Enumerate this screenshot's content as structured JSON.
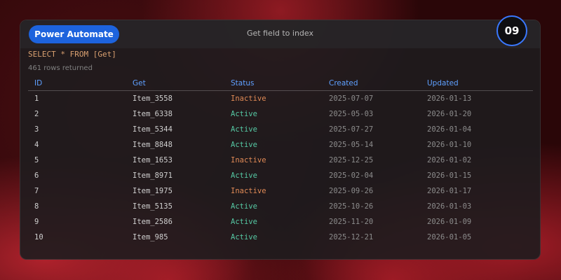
{
  "header": {
    "app_button_label": "Power Automate",
    "title": "Get field to index",
    "step_badge": "09"
  },
  "query": "SELECT * FROM [Get]",
  "row_count_text": "461 rows returned",
  "colors": {
    "accent_blue": "#1d63dd",
    "active_status": "#56c9a4",
    "inactive_status": "#e08a56",
    "header_text": "#5fa0ff"
  },
  "table": {
    "columns": [
      "ID",
      "Get",
      "Status",
      "Created",
      "Updated"
    ],
    "rows": [
      {
        "id": "1",
        "get": "Item_3558",
        "status": "Inactive",
        "created": "2025-07-07",
        "updated": "2026-01-13"
      },
      {
        "id": "2",
        "get": "Item_6338",
        "status": "Active",
        "created": "2025-05-03",
        "updated": "2026-01-20"
      },
      {
        "id": "3",
        "get": "Item_5344",
        "status": "Active",
        "created": "2025-07-27",
        "updated": "2026-01-04"
      },
      {
        "id": "4",
        "get": "Item_8848",
        "status": "Active",
        "created": "2025-05-14",
        "updated": "2026-01-10"
      },
      {
        "id": "5",
        "get": "Item_1653",
        "status": "Inactive",
        "created": "2025-12-25",
        "updated": "2026-01-02"
      },
      {
        "id": "6",
        "get": "Item_8971",
        "status": "Active",
        "created": "2025-02-04",
        "updated": "2026-01-15"
      },
      {
        "id": "7",
        "get": "Item_1975",
        "status": "Inactive",
        "created": "2025-09-26",
        "updated": "2026-01-17"
      },
      {
        "id": "8",
        "get": "Item_5135",
        "status": "Active",
        "created": "2025-10-26",
        "updated": "2026-01-03"
      },
      {
        "id": "9",
        "get": "Item_2586",
        "status": "Active",
        "created": "2025-11-20",
        "updated": "2026-01-09"
      },
      {
        "id": "10",
        "get": "Item_985",
        "status": "Active",
        "created": "2025-12-21",
        "updated": "2026-01-05"
      }
    ]
  }
}
